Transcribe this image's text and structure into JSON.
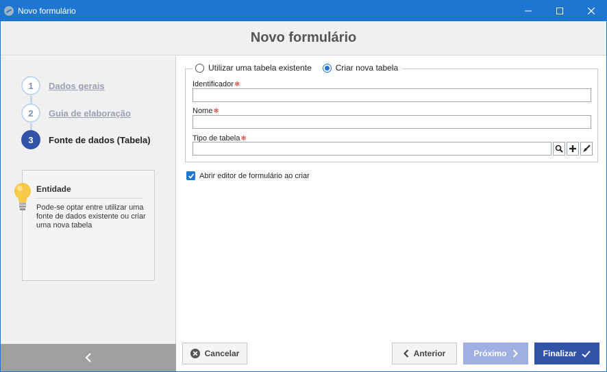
{
  "window": {
    "title": "Novo formulário",
    "minimize_glyph": "—",
    "maximize_glyph": "☐",
    "close_glyph": "✕"
  },
  "header": {
    "title": "Novo formulário"
  },
  "steps": [
    {
      "number": "1",
      "label": "Dados gerais",
      "state": "done"
    },
    {
      "number": "2",
      "label": "Guia de elaboração",
      "state": "done"
    },
    {
      "number": "3",
      "label": "Fonte de dados (Tabela)",
      "state": "active"
    }
  ],
  "info_card": {
    "title": "Entidade",
    "text": "Pode-se optar entre utilizar uma fonte de dados existente ou criar uma nova tabela"
  },
  "source_options": {
    "existing_label": "Utilizar uma tabela existente",
    "new_label": "Criar nova tabela",
    "selected": "new"
  },
  "fields": {
    "identifier": {
      "label": "Identificador",
      "value": ""
    },
    "name": {
      "label": "Nome",
      "value": ""
    },
    "table_type": {
      "label": "Tipo de tabela",
      "value": ""
    },
    "required_marker": "❄"
  },
  "open_editor": {
    "label": "Abrir editor de formulário ao criar",
    "checked": true
  },
  "buttons": {
    "cancel": "Cancelar",
    "previous": "Anterior",
    "next": "Próximo",
    "finish": "Finalizar"
  },
  "colors": {
    "titlebar": "#1e76d2",
    "active_step": "#3353a8",
    "required": "#d32222",
    "disabled_button": "#9fb0e0"
  }
}
